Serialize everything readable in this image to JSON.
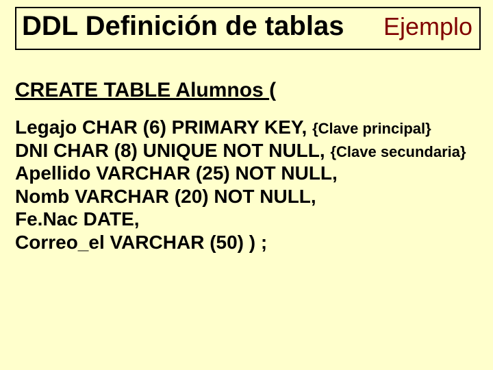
{
  "title": {
    "main": "DDL  Definición de tablas",
    "example": "Ejemplo"
  },
  "create": {
    "text": "CREATE TABLE Alumnos ",
    "paren": " ("
  },
  "cols": {
    "l1_def": "Legajo   CHAR (6)  PRIMARY KEY,    ",
    "l1_comment": "{Clave principal}",
    "l2_def": "DNI  CHAR (8) UNIQUE NOT NULL, ",
    "l2_comment": "{Clave secundaria}",
    "l3": "Apellido  VARCHAR (25)  NOT NULL,",
    "l4": "Nomb VARCHAR (20)  NOT NULL,",
    "l5": "Fe.Nac  DATE,",
    "l6": "Correo_el  VARCHAR (50)   ) ;"
  }
}
